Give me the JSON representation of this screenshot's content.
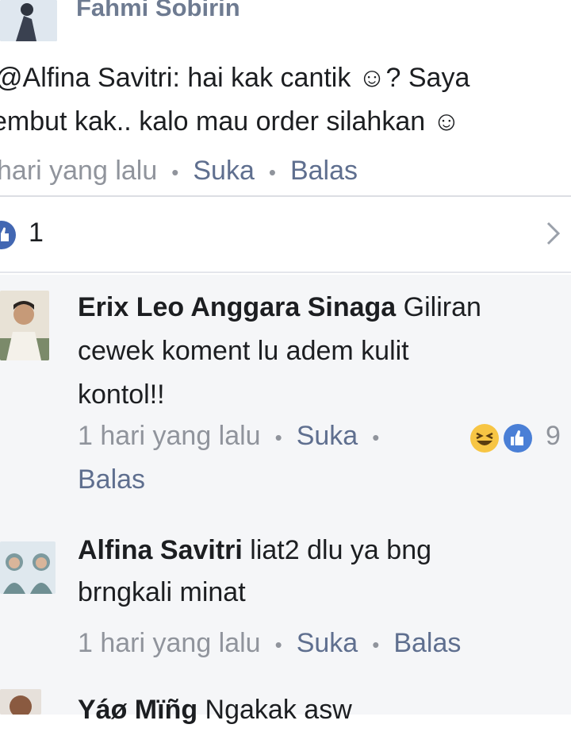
{
  "top_comment": {
    "author": "Fahmi Sobirin",
    "line1": "@Alfina Savitri: hai kak cantik ☺? Saya",
    "line2": "embut kak..  kalo mau order silahkan ☺",
    "time": "hari yang lalu",
    "like_label": "Suka",
    "reply_label": "Balas"
  },
  "likes_bar": {
    "count": "1",
    "chevron": ">"
  },
  "replies": [
    {
      "author": "Erix Leo Anggara Sinaga",
      "text_line1": " Giliran",
      "text_line2": "cewek koment lu adem kulit",
      "text_line3": "kontol!!",
      "time": "1 hari yang lalu",
      "like_label": "Suka",
      "reaction_count": "9",
      "reply_label": "Balas",
      "reactions": [
        "laugh-icon",
        "like-icon"
      ]
    },
    {
      "author": "Alfina Savitri",
      "text_line1": " liat2 dlu ya bng",
      "text_line2": "brngkali minat",
      "time": "1 hari yang lalu",
      "like_label": "Suka",
      "reply_label": "Balas"
    },
    {
      "author": "Yáø Mïñg",
      "text_line1": " Ngakak asw"
    }
  ],
  "colors": {
    "facebook_blue": "#4267b2",
    "link_gray": "#5f6f8f",
    "meta_gray": "#90949c",
    "reply_bg": "#f5f6f8"
  }
}
